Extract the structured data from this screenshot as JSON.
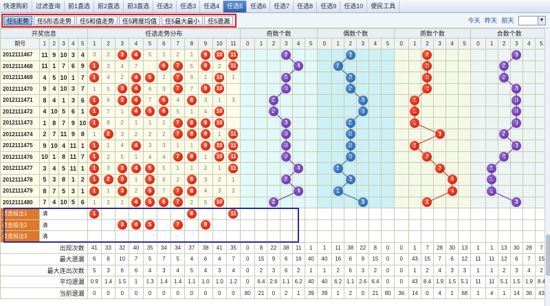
{
  "top_tabs": [
    "快速购彩",
    "过滤查询",
    "前1直选",
    "前2直选",
    "前3直选",
    "任选2",
    "任选3",
    "任选4",
    "任选5",
    "任选6",
    "任选7",
    "任选8",
    "任选9",
    "任选10",
    "便民工具"
  ],
  "active_top_tab": 8,
  "sub_tabs": [
    "任5走势",
    "任5形态走势",
    "任5和值走势",
    "任5跨度均值",
    "任5最大最小",
    "任5遗漏"
  ],
  "active_sub_tab": 0,
  "day_links": [
    "今天",
    "昨天",
    "前天"
  ],
  "issue_select_value": "",
  "groups": {
    "lottery_info": "开奖信息",
    "select_dist": "任选走势分布",
    "odd_count": "奇数个数",
    "even_count": "偶数个数",
    "prime_count": "质数个数",
    "composite_count": "合数个数"
  },
  "issue_header": "期号",
  "col_numbers": [
    "1",
    "2",
    "3",
    "4",
    "5",
    "6",
    "7",
    "8",
    "9",
    "10",
    "11"
  ],
  "count_headers": [
    "0",
    "1",
    "2",
    "3",
    "4",
    "5"
  ],
  "rows": [
    {
      "issue": "2012111467",
      "nums": [
        11,
        9,
        10,
        3,
        4
      ],
      "odd": 3,
      "even": 2,
      "prime": 2,
      "composite": 3
    },
    {
      "issue": "2012111468",
      "nums": [
        11,
        1,
        7,
        6,
        9
      ],
      "odd": 4,
      "even": 1,
      "prime": 2,
      "composite": 2
    },
    {
      "issue": "2012111469",
      "nums": [
        4,
        5,
        10,
        1,
        7
      ],
      "odd": 3,
      "even": 2,
      "prime": 2,
      "composite": 2
    },
    {
      "issue": "2012111470",
      "nums": [
        9,
        4,
        10,
        3,
        7
      ],
      "odd": 3,
      "even": 2,
      "prime": 2,
      "composite": 3
    },
    {
      "issue": "2012111471",
      "nums": [
        8,
        4,
        1,
        3,
        6
      ],
      "odd": 2,
      "even": 3,
      "prime": 1,
      "composite": 3
    },
    {
      "issue": "2012111472",
      "nums": [
        4,
        10,
        5,
        6,
        1
      ],
      "odd": 2,
      "even": 3,
      "prime": 1,
      "composite": 3
    },
    {
      "issue": "2012111473",
      "nums": [
        1,
        8,
        7,
        9,
        10
      ],
      "odd": 3,
      "even": 2,
      "prime": 1,
      "composite": 3
    },
    {
      "issue": "2012111474",
      "nums": [
        2,
        7,
        11,
        9,
        8
      ],
      "odd": 3,
      "even": 2,
      "prime": 3,
      "composite": 2
    },
    {
      "issue": "2012111475",
      "nums": [
        9,
        10,
        4,
        11,
        1
      ],
      "odd": 3,
      "even": 2,
      "prime": 1,
      "composite": 3
    },
    {
      "issue": "2012111476",
      "nums": [
        10,
        1,
        8,
        11,
        7
      ],
      "odd": 3,
      "even": 2,
      "prime": 2,
      "composite": 2
    },
    {
      "issue": "2012111477",
      "nums": [
        3,
        4,
        5,
        11,
        1
      ],
      "odd": 4,
      "even": 1,
      "prime": 3,
      "composite": 1
    },
    {
      "issue": "2012111478",
      "nums": [
        5,
        3,
        8,
        1,
        2
      ],
      "odd": 3,
      "even": 2,
      "prime": 4,
      "composite": 1
    },
    {
      "issue": "2012111479",
      "nums": [
        8,
        7,
        5,
        3,
        1
      ],
      "odd": 4,
      "even": 1,
      "prime": 4,
      "composite": 1
    },
    {
      "issue": "2012111480",
      "nums": [
        7,
        4,
        10,
        5,
        6
      ],
      "odd": 2,
      "even": 3,
      "prime": 2,
      "composite": 3
    }
  ],
  "miss_values": [
    [
      "3",
      "2",
      "",
      "",
      "5",
      "1",
      "2",
      "1",
      "",
      "",
      ""
    ],
    [
      "",
      "3",
      "4",
      "7",
      "",
      "",
      "",
      "5",
      "",
      "2",
      ""
    ],
    [
      "",
      "4",
      "2",
      "",
      "",
      "2",
      "",
      "6",
      "1",
      "",
      "1"
    ],
    [
      "1",
      "5",
      "",
      "",
      "6",
      "3",
      "",
      "7",
      "",
      "",
      ""
    ],
    [
      "",
      "6",
      "",
      "",
      "7",
      "",
      "4",
      "",
      "3",
      "1",
      "3"
    ],
    [
      "1",
      "7",
      "1",
      "",
      "",
      "",
      "5",
      "1",
      "4",
      "",
      ""
    ],
    [
      "",
      "8",
      "2",
      "1",
      "1",
      "1",
      "",
      "",
      "",
      "",
      ""
    ],
    [
      "1",
      "",
      "3",
      "2",
      "2",
      "2",
      "",
      "",
      "",
      "1",
      "2"
    ],
    [
      "",
      "1",
      "4",
      "",
      "3",
      "3",
      "1",
      "1",
      "",
      "",
      " "
    ],
    [
      "1",
      "2",
      "5",
      "1",
      "4",
      "4",
      "",
      "",
      "1",
      "",
      ""
    ],
    [
      "",
      "3",
      "",
      "",
      "",
      "5",
      "1",
      "1",
      "2",
      "1",
      ""
    ],
    [
      "",
      "",
      "",
      "1",
      "",
      "6",
      "2",
      "",
      "3",
      "2",
      "1"
    ],
    [
      "",
      "1",
      "",
      "2",
      "",
      "7",
      "",
      "1",
      "4",
      "3",
      "2"
    ],
    [
      "1",
      "2",
      "1",
      "",
      "",
      "",
      "",
      "2",
      "5",
      "",
      ""
    ]
  ],
  "pick_rows": [
    {
      "label": "点击投注1",
      "clear": "清",
      "selected": [
        1,
        8,
        11
      ]
    },
    {
      "label": "点击投注2",
      "clear": "清",
      "selected": [
        3,
        4,
        5,
        7,
        9
      ]
    },
    {
      "label": "点击投注3",
      "clear": "清",
      "selected": []
    }
  ],
  "stats": [
    {
      "label": "出现次数",
      "select": [
        "41",
        "33",
        "32",
        "40",
        "35",
        "34",
        "34",
        "37",
        "38",
        "41",
        "35"
      ],
      "odd": [
        "0",
        "8",
        "22",
        "38",
        "11",
        "1"
      ],
      "even": [
        "1",
        "11",
        "38",
        "22",
        "8",
        "0"
      ],
      "prime": [
        "0",
        "1",
        "7",
        "28",
        "30",
        "13"
      ],
      "composite": [
        "1",
        "1",
        "13",
        "30",
        "28",
        "7"
      ]
    },
    {
      "label": "最大遗漏",
      "select": [
        "6",
        "8",
        "10",
        "7",
        "5",
        "7",
        "5",
        "4",
        "6",
        "4",
        "7"
      ],
      "odd": [
        "0",
        "15",
        "9",
        "6",
        "16",
        "40"
      ],
      "even": [
        "40",
        "16",
        "6",
        "9",
        "15",
        "0"
      ],
      "prime": [
        "0",
        "43",
        "15",
        "7",
        "6",
        "12"
      ],
      "composite": [
        "11",
        "11",
        "12",
        "6",
        "7",
        "15"
      ]
    },
    {
      "label": "最大连出次数",
      "select": [
        "5",
        "3",
        "6",
        "6",
        "4",
        "3",
        "4",
        "5",
        "4",
        "3",
        "4"
      ],
      "odd": [
        "0",
        "2",
        "3",
        "6",
        "2",
        "1"
      ],
      "even": [
        "1",
        "2",
        "6",
        "3",
        "2",
        "0"
      ],
      "prime": [
        "0",
        "1",
        "2",
        "4",
        "3",
        "3"
      ],
      "composite": [
        "1",
        "1",
        "2",
        "3",
        "4",
        "2"
      ]
    },
    {
      "label": "平均遗漏",
      "select": [
        "0.9",
        "1.4",
        "1.5",
        "1",
        "1.3",
        "1.4",
        "1.4",
        "1.1",
        "1.0",
        "1.0",
        "1.2"
      ],
      "odd": [
        "0",
        "6.4",
        "2.6",
        "1.1",
        "6.2",
        "40"
      ],
      "even": [
        "40",
        "6.2",
        "1.1",
        "2.6",
        "6.4",
        "0"
      ],
      "prime": [
        "0",
        "43",
        "8.4",
        "1.9",
        "1.5",
        "5.1"
      ],
      "composite": [
        "11",
        "11",
        "5.1",
        "1.5",
        "1.9",
        "8.4"
      ]
    },
    {
      "label": "当前遗漏",
      "select": [
        "0",
        "0",
        "0",
        "0",
        "0",
        "0",
        "0",
        "0",
        "0",
        "0",
        "0"
      ],
      "odd": [
        "80",
        "21",
        "0",
        "2",
        "1",
        "39"
      ],
      "even": [
        "39",
        "1",
        "2",
        "0",
        "21",
        "80"
      ],
      "prime": [
        "36",
        "14",
        "0",
        "4",
        "1",
        "68"
      ],
      "composite": [
        "1",
        "4",
        "1",
        "14",
        "36",
        "43"
      ]
    }
  ],
  "colors": {
    "accent_active_tab": "#2e62a8",
    "ball_red": "#d8281a",
    "ball_blue": "#2a66b0",
    "ball_purple": "#6a37a8",
    "highlight_box": "#e11",
    "pick_box": "#2a2aa0",
    "pick_label_bg": "#e0782a"
  }
}
